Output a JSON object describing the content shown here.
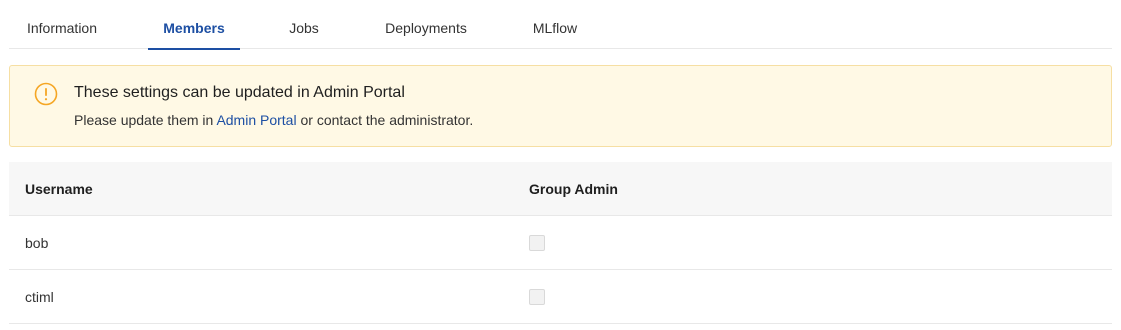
{
  "tabs": [
    {
      "label": "Information",
      "active": false
    },
    {
      "label": "Members",
      "active": true
    },
    {
      "label": "Jobs",
      "active": false
    },
    {
      "label": "Deployments",
      "active": false
    },
    {
      "label": "MLflow",
      "active": false
    }
  ],
  "alert": {
    "icon": "warning-circle-icon",
    "title": "These settings can be updated in Admin Portal",
    "desc_prefix": "Please update them in ",
    "link_label": "Admin Portal",
    "desc_suffix": " or contact the administrator.",
    "accent_color": "#f5a623"
  },
  "table": {
    "columns": [
      "Username",
      "Group Admin"
    ],
    "rows": [
      {
        "username": "bob",
        "group_admin": false,
        "disabled": true
      },
      {
        "username": "ctiml",
        "group_admin": false,
        "disabled": true
      }
    ]
  },
  "colors": {
    "active_tab": "#1d4fa3",
    "alert_bg": "#fff9e5",
    "alert_border": "#f6dfa3"
  }
}
